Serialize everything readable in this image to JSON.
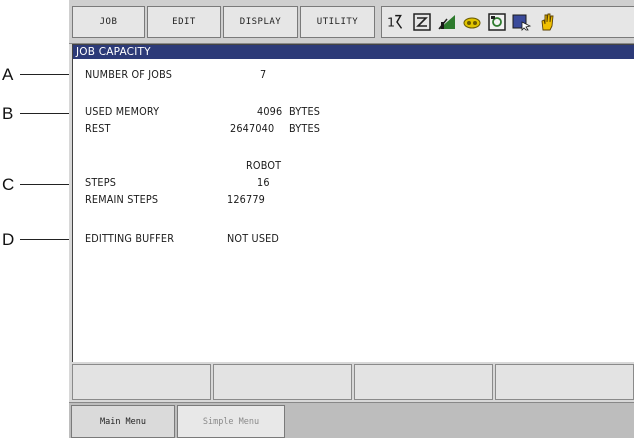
{
  "callouts": [
    "A",
    "B",
    "C",
    "D"
  ],
  "menu": {
    "job": "JOB",
    "edit": "EDIT",
    "display": "DISPLAY",
    "utility": "UTILITY"
  },
  "status_icons": [
    "axes-icon",
    "teach-icon",
    "signal-icon",
    "tool-icon",
    "robot-icon",
    "pointer-icon",
    "hand-icon"
  ],
  "screen": {
    "title": "JOB CAPACITY",
    "number_of_jobs_label": "NUMBER OF JOBS",
    "number_of_jobs_value": "7",
    "used_memory_label": "USED MEMORY",
    "used_memory_value": "4096",
    "used_memory_unit": "BYTES",
    "rest_label": "REST",
    "rest_value": "2647040",
    "rest_unit": "BYTES",
    "robot_header": "ROBOT",
    "steps_label": "STEPS",
    "steps_value": "16",
    "remain_steps_label": "REMAIN STEPS",
    "remain_steps_value": "126779",
    "editing_buffer_label": "EDITTING BUFFER",
    "editing_buffer_value": "NOT USED"
  },
  "bottom": {
    "main_menu": "Main Menu",
    "simple_menu": "Simple Menu"
  },
  "colors": {
    "title_bar": "#2c3a78",
    "panel": "#d8d8d8",
    "screen_bg": "#ffffff"
  }
}
